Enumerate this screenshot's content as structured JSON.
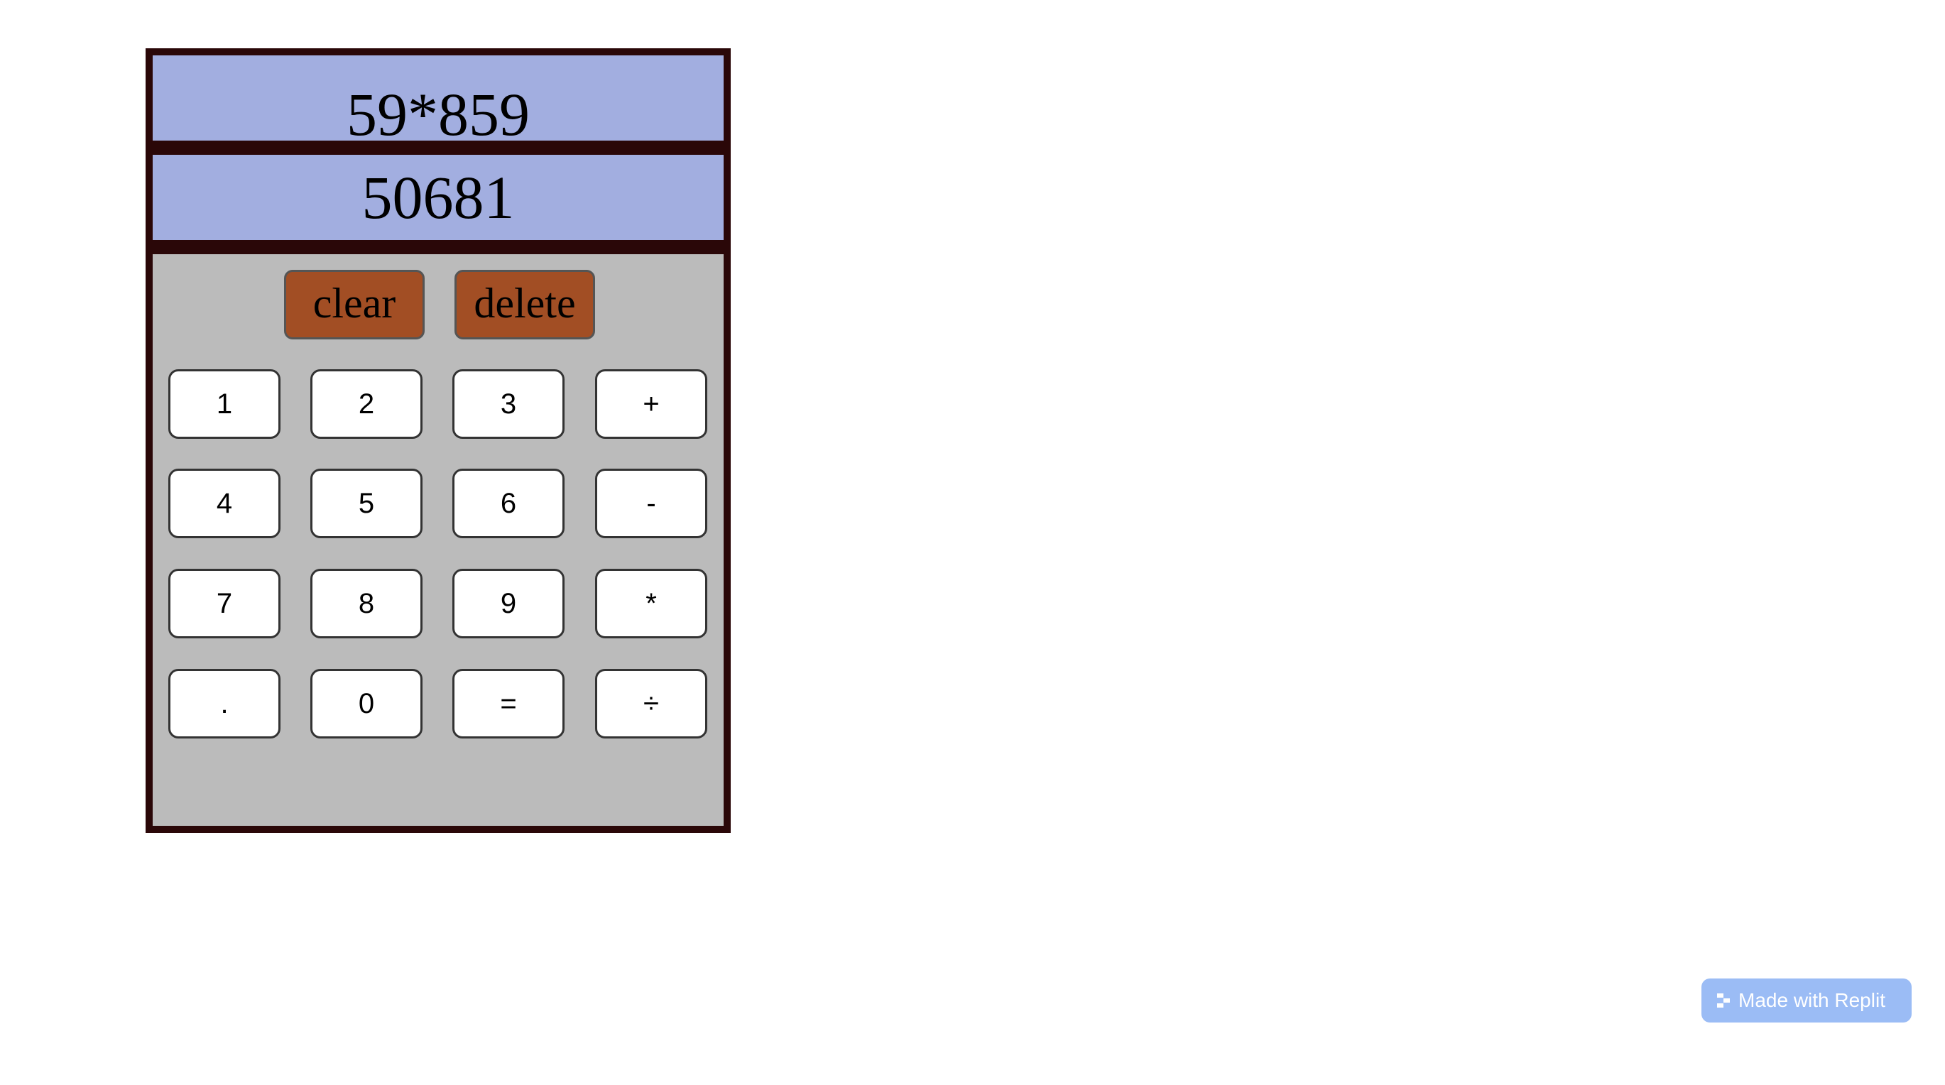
{
  "calculator": {
    "previous_operand": "59*859",
    "current_operand": "50681",
    "function_buttons": {
      "clear": "clear",
      "delete": "delete"
    },
    "keys": [
      [
        "1",
        "2",
        "3",
        "+"
      ],
      [
        "4",
        "5",
        "6",
        "-"
      ],
      [
        "7",
        "8",
        "9",
        "*"
      ],
      [
        ".",
        "0",
        "=",
        "÷"
      ]
    ]
  },
  "badge": {
    "label": "Made with Replit",
    "icon": "replit-icon"
  },
  "colors": {
    "frame": "#2a0708",
    "display_bg": "#a2aee0",
    "keypad_bg": "#bbbbbb",
    "function_button": "#a24e24",
    "badge_bg": "#9bbcf5"
  }
}
